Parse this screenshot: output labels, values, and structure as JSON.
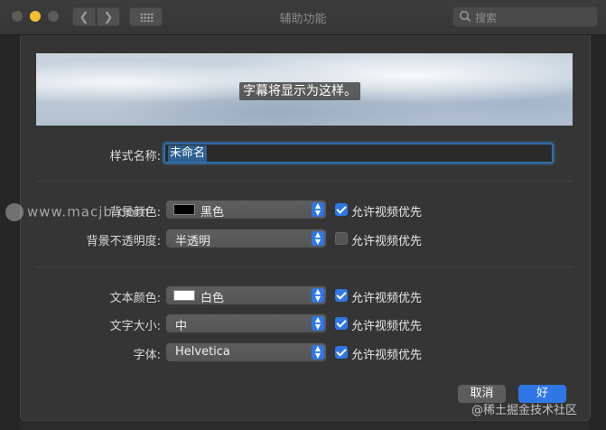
{
  "window": {
    "title": "辅助功能"
  },
  "search": {
    "placeholder": "搜索"
  },
  "preview": {
    "caption": "字幕将显示为这样。"
  },
  "form": {
    "style_name_label": "样式名称:",
    "style_name_value": "未命名",
    "rows": [
      {
        "label": "背景颜色:",
        "value": "黑色",
        "swatch": "#000000",
        "allow_video": true
      },
      {
        "label": "背景不透明度:",
        "value": "半透明",
        "allow_video": false
      },
      {
        "label": "文本颜色:",
        "value": "白色",
        "swatch": "#ffffff",
        "allow_video": true
      },
      {
        "label": "文字大小:",
        "value": "中",
        "allow_video": true
      },
      {
        "label": "字体:",
        "value": "Helvetica",
        "allow_video": true
      }
    ],
    "allow_video_label": "允许视频优先"
  },
  "buttons": {
    "cancel": "取消",
    "ok": "好"
  },
  "watermarks": {
    "left": "www.macjb.com",
    "right": "@稀土掘金技术社区"
  },
  "colors": {
    "accent": "#2f77e6",
    "window_bg": "#353535"
  }
}
